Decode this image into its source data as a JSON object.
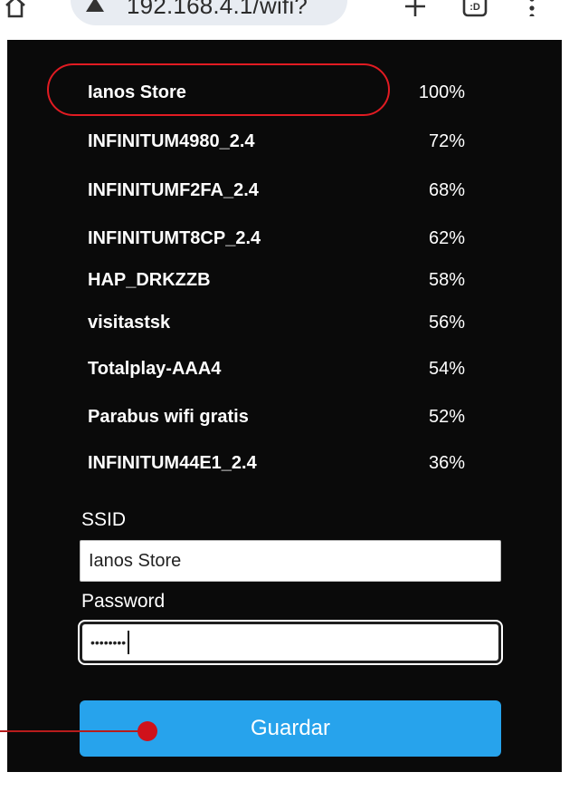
{
  "browser": {
    "url": "192.168.4.1/wifi?",
    "icons": [
      "home-icon",
      "lock-icon",
      "plus-icon",
      "tabs-icon",
      "menu-icon"
    ],
    "tabs_badge": ":D"
  },
  "networks": [
    {
      "ssid": "Ianos Store",
      "signal": "100%"
    },
    {
      "ssid": "INFINITUM4980_2.4",
      "signal": "72%"
    },
    {
      "ssid": "INFINITUMF2FA_2.4",
      "signal": "68%"
    },
    {
      "ssid": "INFINITUMT8CP_2.4",
      "signal": "62%"
    },
    {
      "ssid": "HAP_DRKZZB",
      "signal": "58%"
    },
    {
      "ssid": "visitastsk",
      "signal": "56%"
    },
    {
      "ssid": "Totalplay-AAA4",
      "signal": "54%"
    },
    {
      "ssid": "Parabus wifi gratis",
      "signal": "52%"
    },
    {
      "ssid": "INFINITUM44E1_2.4",
      "signal": "36%"
    }
  ],
  "form": {
    "ssid_label": "SSID",
    "ssid_value": "Ianos Store",
    "password_label": "Password",
    "password_masked": "••••••••",
    "save_label": "Guardar"
  },
  "colors": {
    "background": "#0a0a0a",
    "button": "#27a3ec",
    "highlight": "#e11b22"
  }
}
